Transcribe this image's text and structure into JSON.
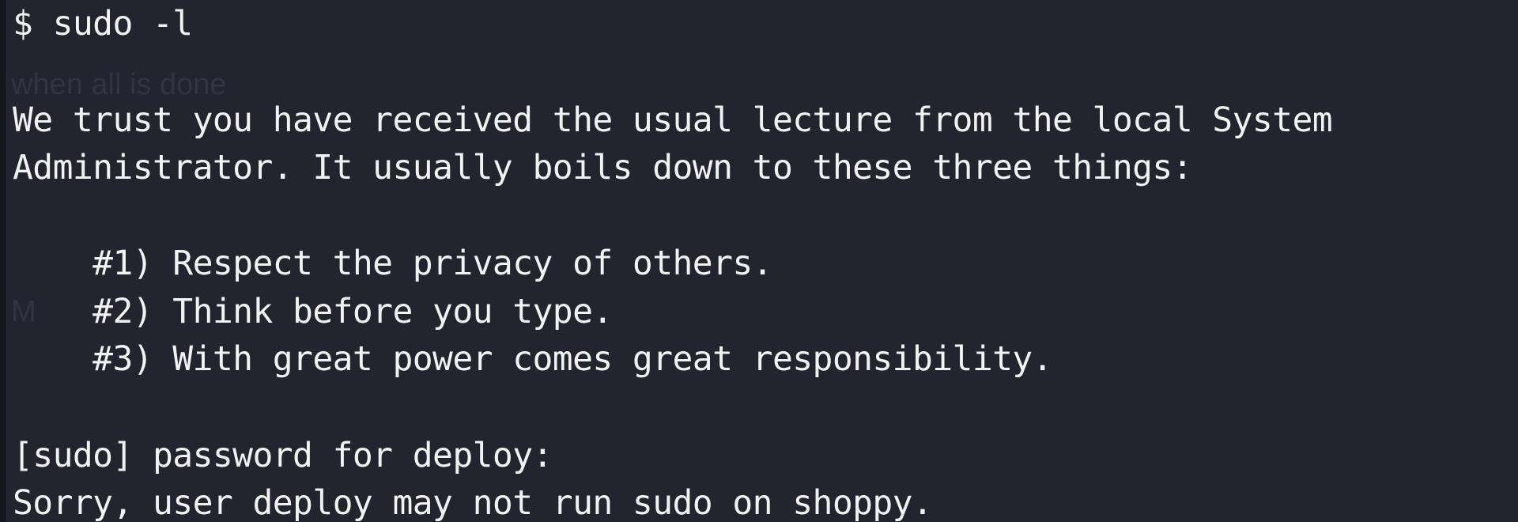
{
  "terminal": {
    "background_color": "#23242e",
    "text_color": "#f2f2f2",
    "ghost_text": {
      "a": "when all is done",
      "b": "M"
    },
    "lines": [
      "$ sudo -l",
      "",
      "We trust you have received the usual lecture from the local System",
      "Administrator. It usually boils down to these three things:",
      "",
      "    #1) Respect the privacy of others.",
      "    #2) Think before you type.",
      "    #3) With great power comes great responsibility.",
      "",
      "[sudo] password for deploy:",
      "Sorry, user deploy may not run sudo on shoppy."
    ]
  }
}
